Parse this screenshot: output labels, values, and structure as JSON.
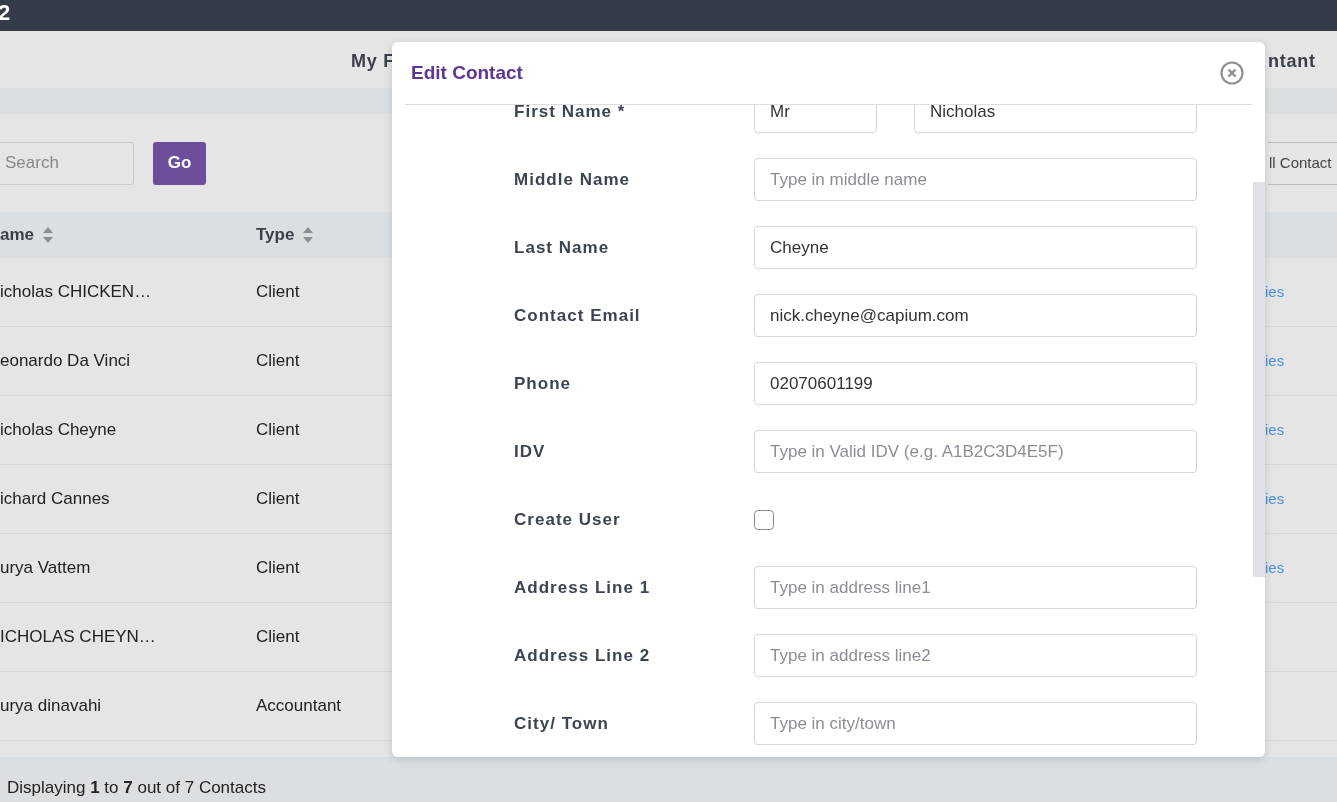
{
  "top_nav": {
    "brand": "2"
  },
  "sub_nav": {
    "left": "My F",
    "right": "ntant"
  },
  "toolbar": {
    "search": {
      "placeholder": "Search"
    },
    "go_button": "Go",
    "right_button": "ll Contact"
  },
  "table": {
    "columns": [
      {
        "label": "ame",
        "sortable": true
      },
      {
        "label": "Type",
        "sortable": true
      }
    ],
    "rows": [
      {
        "name": "icholas CHICKEN…",
        "type": "Client",
        "link": "ies"
      },
      {
        "name": "eonardo Da Vinci",
        "type": "Client",
        "link": "ies"
      },
      {
        "name": "icholas Cheyne",
        "type": "Client",
        "link": "ies"
      },
      {
        "name": "ichard Cannes",
        "type": "Client",
        "link": "ies"
      },
      {
        "name": "urya Vattem",
        "type": "Client",
        "link": "ies"
      },
      {
        "name": "ICHOLAS CHEYN…",
        "type": "Client"
      },
      {
        "name": "urya dinavahi",
        "type": "Accountant"
      }
    ]
  },
  "footer": "Displaying **1** to **7** out of 7 Contacts",
  "modal": {
    "title": "Edit Contact",
    "fields": [
      {
        "kind": "name",
        "label": "First Name *",
        "title_value": "Mr",
        "value": "Nicholas"
      },
      {
        "kind": "text",
        "label": "Middle Name",
        "placeholder": "Type in middle name"
      },
      {
        "kind": "text",
        "label": "Last Name",
        "value": "Cheyne"
      },
      {
        "kind": "text",
        "label": "Contact Email",
        "value": "nick.cheyne@capium.com"
      },
      {
        "kind": "text",
        "label": "Phone",
        "value": "02070601199"
      },
      {
        "kind": "text",
        "label": "IDV",
        "placeholder": "Type in Valid IDV (e.g. A1B2C3D4E5F)"
      },
      {
        "kind": "checkbox",
        "label": "Create User",
        "checked": false
      },
      {
        "kind": "text",
        "label": "Address Line 1",
        "placeholder": "Type in address line1"
      },
      {
        "kind": "text",
        "label": "Address Line 2",
        "placeholder": "Type in address line2"
      },
      {
        "kind": "text",
        "label": "City/ Town",
        "placeholder": "Type in city/town"
      }
    ]
  }
}
